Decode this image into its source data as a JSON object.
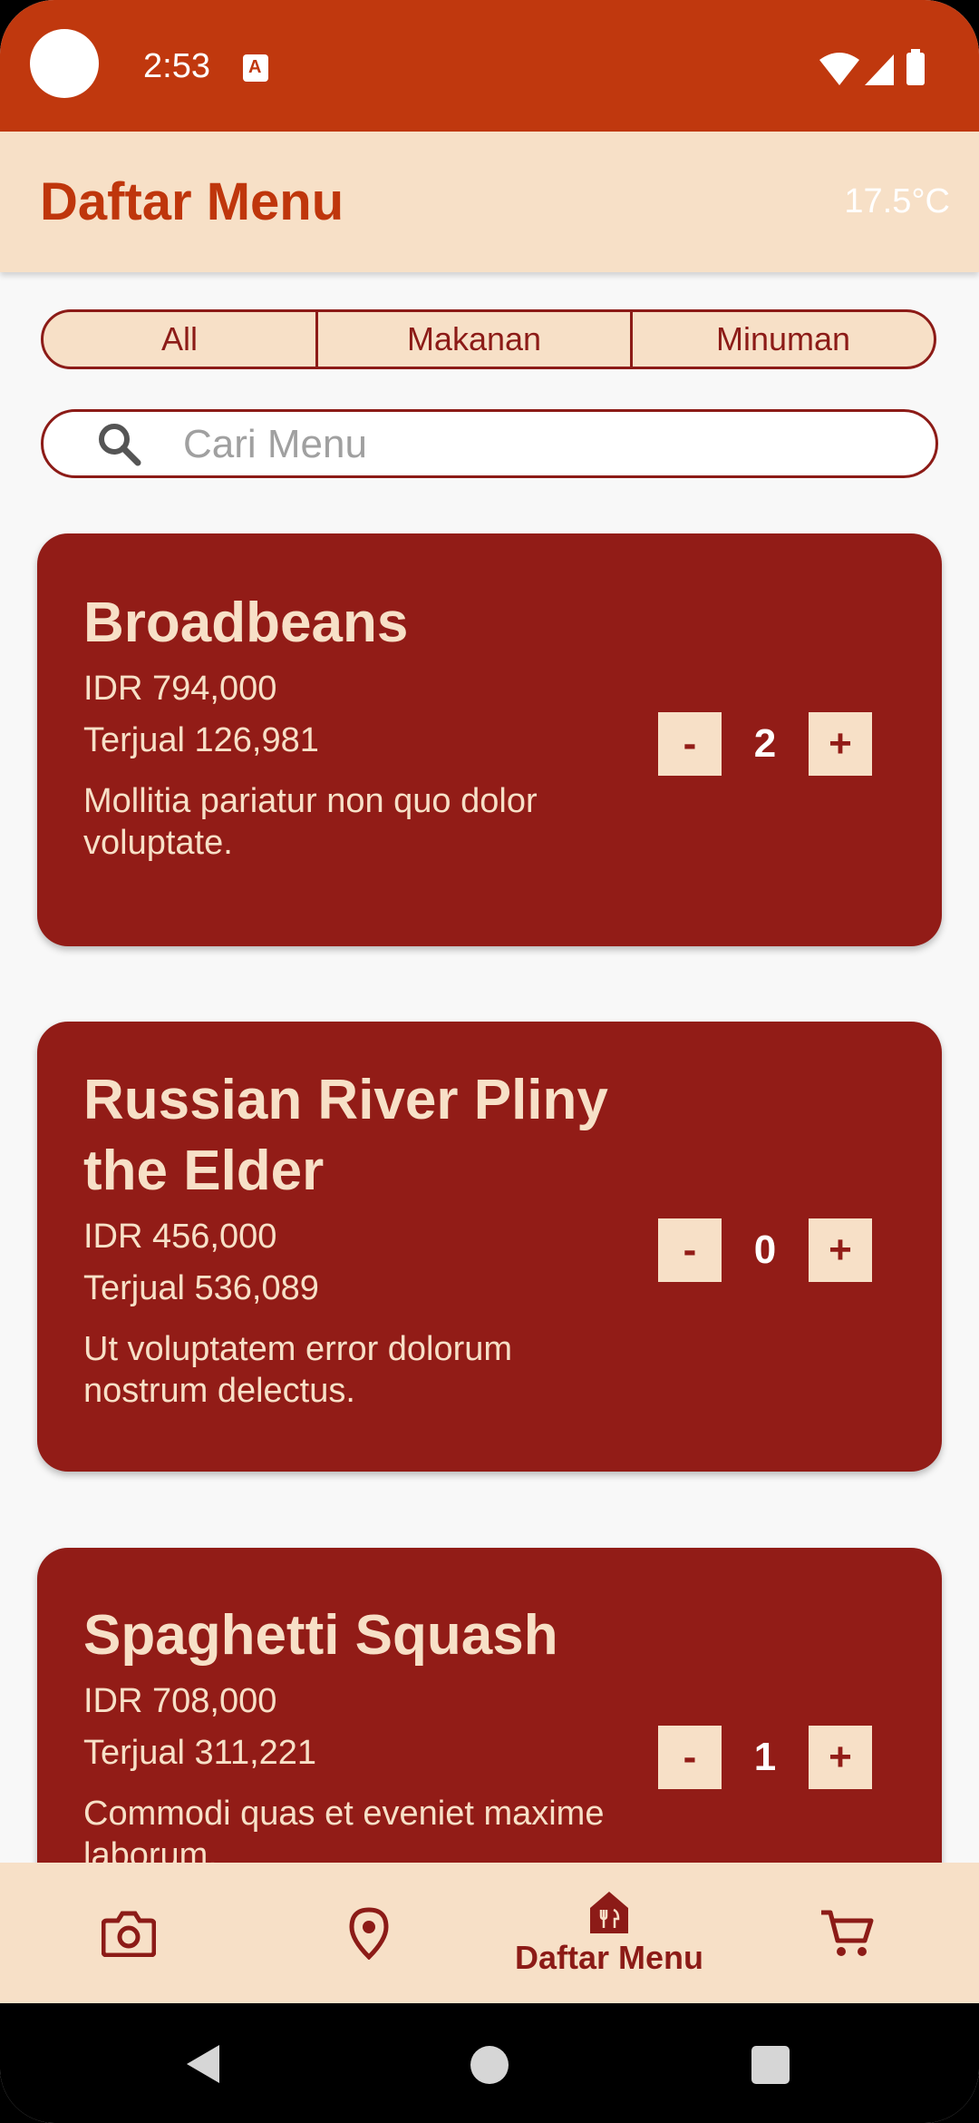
{
  "status_bar": {
    "time": "2:53",
    "notification_glyph": "A"
  },
  "app_bar": {
    "title": "Daftar Menu",
    "temperature": "17.5°C"
  },
  "filter_tabs": [
    {
      "label": "All"
    },
    {
      "label": "Makanan"
    },
    {
      "label": "Minuman"
    }
  ],
  "search": {
    "placeholder": "Cari Menu",
    "value": ""
  },
  "menu_items": [
    {
      "name": "Broadbeans",
      "price": "IDR 794,000",
      "sold": "Terjual 126,981",
      "description": "Mollitia pariatur non quo dolor voluptate.",
      "quantity": "2",
      "minus_label": "-",
      "plus_label": "+"
    },
    {
      "name": "Russian River Pliny the Elder",
      "price": "IDR 456,000",
      "sold": "Terjual 536,089",
      "description": "Ut voluptatem error dolorum nostrum delectus.",
      "quantity": "0",
      "minus_label": "-",
      "plus_label": "+"
    },
    {
      "name": "Spaghetti Squash",
      "price": "IDR 708,000",
      "sold": "Terjual 311,221",
      "description": "Commodi quas et eveniet maxime laborum.",
      "quantity": "1",
      "minus_label": "-",
      "plus_label": "+"
    }
  ],
  "bottom_nav": {
    "items": [
      {
        "icon": "camera-icon"
      },
      {
        "icon": "location-pin-icon"
      },
      {
        "icon": "restaurant-icon",
        "label": "Daftar Menu",
        "selected": true
      },
      {
        "icon": "cart-icon"
      }
    ]
  },
  "colors": {
    "status_bar": "#c0380e",
    "app_bar": "#f7e0c7",
    "accent": "#bf360c",
    "card": "#921c17",
    "cream": "#f7e0c7"
  }
}
